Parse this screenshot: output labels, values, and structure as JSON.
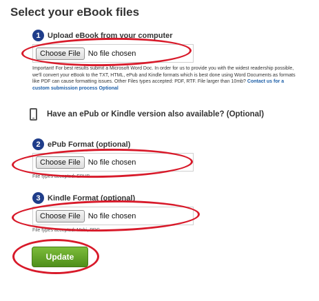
{
  "page_title": "Select your eBook files",
  "step1": {
    "number": "1",
    "label": "Upload eBook from your computer",
    "button_label": "Choose File",
    "status": "No file chosen",
    "note_text": "Important! For best results submit a Microsoft Word Doc. In order for us to provide you with the widest readership possible, we'll convert your eBook to the TXT, HTML, ePub and Kindle formats which is best done using Word Documents as formats like PDF can cause formatting issues. Other Files types accepted: PDF, RTF. File larger than 10mb?",
    "note_link": "Contact us for a custom submission process Optional"
  },
  "alt_versions": {
    "icon": "mobile-device-icon",
    "label": "Have an ePub or Kindle version also available? (Optional)"
  },
  "step2": {
    "number": "2",
    "label": "ePub Format (optional)",
    "button_label": "Choose File",
    "status": "No file chosen",
    "types_note": "File types accepted: EPUB"
  },
  "step3": {
    "number": "3",
    "label": "Kindle Format (optional)",
    "button_label": "Choose File",
    "status": "No file chosen",
    "types_note": "File types accepted: Mobi, PRC"
  },
  "update_label": "Update",
  "colors": {
    "step_badge": "#1f3d8a",
    "link": "#1d5fa8",
    "update_button": "#6aa82c",
    "annotation_red": "#d81a2a"
  }
}
